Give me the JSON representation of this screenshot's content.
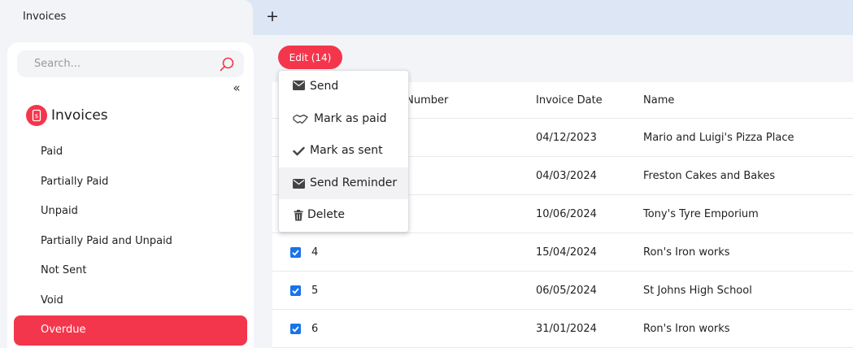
{
  "tabs": {
    "active_label": "Invoices",
    "add_label": "+"
  },
  "sidebar": {
    "search_placeholder": "Search...",
    "collapse_label": "«",
    "section_title": "Invoices",
    "items": [
      {
        "label": "Paid"
      },
      {
        "label": "Partially Paid"
      },
      {
        "label": "Unpaid"
      },
      {
        "label": "Partially Paid and Unpaid"
      },
      {
        "label": "Not Sent"
      },
      {
        "label": "Void"
      },
      {
        "label": "Overdue",
        "active": true
      }
    ]
  },
  "toolbar": {
    "edit_label": "Edit (14)"
  },
  "menu": {
    "items": [
      {
        "label": "Send",
        "icon": "envelope-icon"
      },
      {
        "label": "Mark as paid",
        "icon": "handshake-icon"
      },
      {
        "label": "Mark as sent",
        "icon": "check-icon"
      },
      {
        "label": "Send Reminder",
        "icon": "envelope-icon",
        "hover": true
      },
      {
        "label": "Delete",
        "icon": "trash-icon"
      }
    ]
  },
  "table": {
    "columns": [
      "e Number",
      "Invoice Date",
      "Name"
    ],
    "rows": [
      {
        "number": "",
        "date": "04/12/2023",
        "name": "Mario and Luigi's Pizza Place",
        "checked": true
      },
      {
        "number": "",
        "date": "04/03/2024",
        "name": "Freston Cakes and Bakes",
        "checked": true
      },
      {
        "number": "",
        "date": "10/06/2024",
        "name": "Tony's Tyre Emporium",
        "checked": true
      },
      {
        "number": "4",
        "date": "15/04/2024",
        "name": "Ron's Iron works",
        "checked": true
      },
      {
        "number": "5",
        "date": "06/05/2024",
        "name": "St Johns High School",
        "checked": true
      },
      {
        "number": "6",
        "date": "31/01/2024",
        "name": "Ron's Iron works",
        "checked": true
      }
    ]
  },
  "colors": {
    "accent": "#f4364c",
    "checkbox": "#1a73e8",
    "tabbar": "#dce6f4",
    "page_bg": "#f2f4f8"
  }
}
